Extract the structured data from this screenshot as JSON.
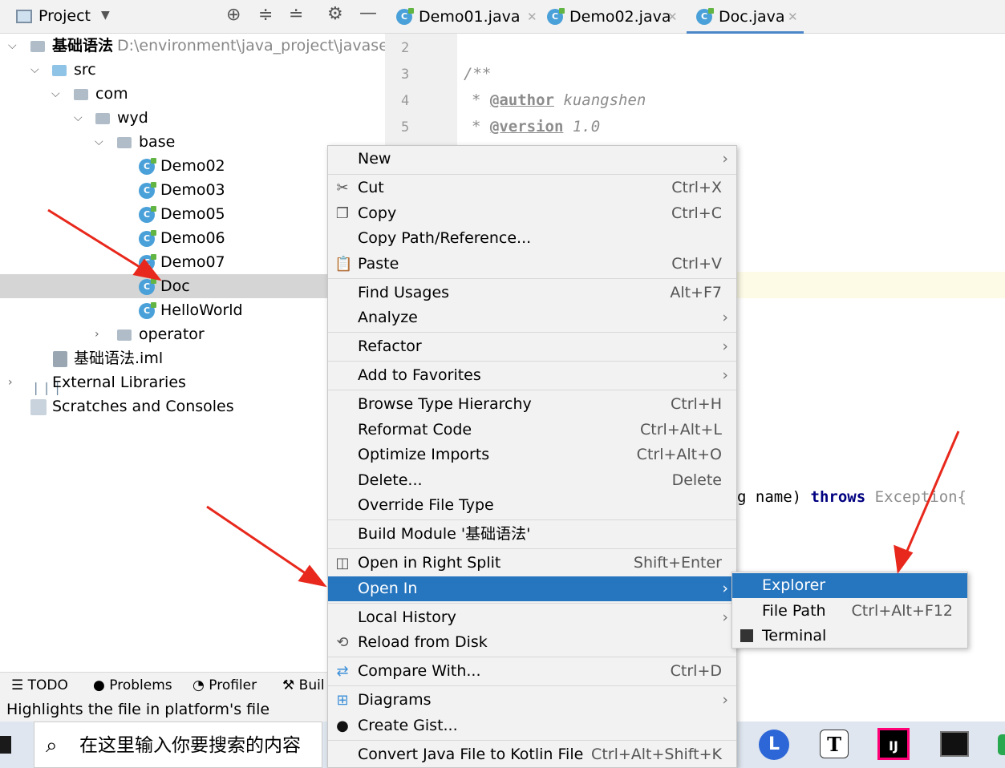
{
  "project_panel": {
    "title": "Project",
    "root": {
      "name": "基础语法",
      "path": "D:\\environment\\java_project\\javase\\基础"
    },
    "tree": [
      "src",
      "com",
      "wyd",
      "base",
      "Demo02",
      "Demo03",
      "Demo05",
      "Demo06",
      "Demo07",
      "Doc",
      "HelloWorld",
      "operator",
      "基础语法.iml",
      "External Libraries",
      "Scratches and Consoles"
    ]
  },
  "editor": {
    "tabs": [
      "Demo01.java",
      "Demo02.java",
      "Doc.java"
    ],
    "line_numbers": [
      "2",
      "3",
      "4",
      "5"
    ],
    "code": {
      "line3": "/**",
      "author_tag": "@author",
      "author": "kuangshen",
      "version_tag": "@version",
      "version": "1.0",
      "fragment_name": "g name)",
      "fragment_throws": "throws",
      "fragment_exception": "Exception{"
    }
  },
  "context_menu": {
    "items": [
      {
        "label": "New",
        "shortcut": ""
      },
      {
        "label": "Cut",
        "shortcut": "Ctrl+X"
      },
      {
        "label": "Copy",
        "shortcut": "Ctrl+C"
      },
      {
        "label": "Copy Path/Reference...",
        "shortcut": ""
      },
      {
        "label": "Paste",
        "shortcut": "Ctrl+V"
      },
      {
        "label": "Find Usages",
        "shortcut": "Alt+F7"
      },
      {
        "label": "Analyze",
        "shortcut": ""
      },
      {
        "label": "Refactor",
        "shortcut": ""
      },
      {
        "label": "Add to Favorites",
        "shortcut": ""
      },
      {
        "label": "Browse Type Hierarchy",
        "shortcut": "Ctrl+H"
      },
      {
        "label": "Reformat Code",
        "shortcut": "Ctrl+Alt+L"
      },
      {
        "label": "Optimize Imports",
        "shortcut": "Ctrl+Alt+O"
      },
      {
        "label": "Delete...",
        "shortcut": "Delete"
      },
      {
        "label": "Override File Type",
        "shortcut": ""
      },
      {
        "label": "Build Module '基础语法'",
        "shortcut": ""
      },
      {
        "label": "Open in Right Split",
        "shortcut": "Shift+Enter"
      },
      {
        "label": "Open In",
        "shortcut": ""
      },
      {
        "label": "Local History",
        "shortcut": ""
      },
      {
        "label": "Reload from Disk",
        "shortcut": ""
      },
      {
        "label": "Compare With...",
        "shortcut": "Ctrl+D"
      },
      {
        "label": "Diagrams",
        "shortcut": ""
      },
      {
        "label": "Create Gist...",
        "shortcut": ""
      },
      {
        "label": "Convert Java File to Kotlin File",
        "shortcut": "Ctrl+Alt+Shift+K"
      }
    ]
  },
  "submenu": {
    "items": [
      {
        "label": "Explorer",
        "shortcut": ""
      },
      {
        "label": "File Path",
        "shortcut": "Ctrl+Alt+F12"
      },
      {
        "label": "Terminal",
        "shortcut": ""
      }
    ]
  },
  "bottom_tabs": [
    "TODO",
    "Problems",
    "Profiler",
    "Buil"
  ],
  "status_text": "Highlights the file in platform's file manager",
  "taskbar": {
    "search_placeholder": "在这里输入你要搜索的内容"
  },
  "colors": {
    "highlight": "#2675bf",
    "arrow": "#e8281c"
  }
}
